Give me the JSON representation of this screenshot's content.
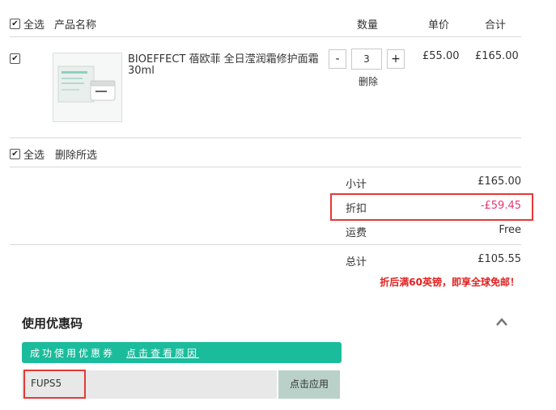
{
  "header": {
    "select_all": "全选",
    "product_name": "产品名称",
    "quantity": "数量",
    "unit_price": "单价",
    "total": "合计"
  },
  "item": {
    "name_line1": "BIOEFFECT 蓓欧菲 全日滢润霜修护面霜",
    "name_line2": "30ml",
    "qty_minus": "-",
    "qty_value": "3",
    "qty_plus": "+",
    "delete": "删除",
    "unit_price": "£55.00",
    "line_total": "£165.00"
  },
  "footer_actions": {
    "select_all": "全选",
    "delete_selected": "删除所选"
  },
  "summary": {
    "subtotal_label": "小计",
    "subtotal_value": "£165.00",
    "discount_label": "折扣",
    "discount_value": "-£59.45",
    "shipping_label": "运费",
    "shipping_value": "Free",
    "total_label": "总计",
    "total_value": "£105.55",
    "promo_note": "折后满60英镑，即享全球免邮！"
  },
  "coupon": {
    "title": "使用优惠码",
    "success_prefix": "成功使用优惠券",
    "success_link": "点击查看原因",
    "code_value": "FUPS5",
    "apply_label": "点击应用"
  },
  "colors": {
    "accent_green": "#1abc9c",
    "discount_pink": "#e8356e",
    "promo_red": "#e02020",
    "highlight_red": "#e53935",
    "apply_bg": "#b9d1c9"
  }
}
